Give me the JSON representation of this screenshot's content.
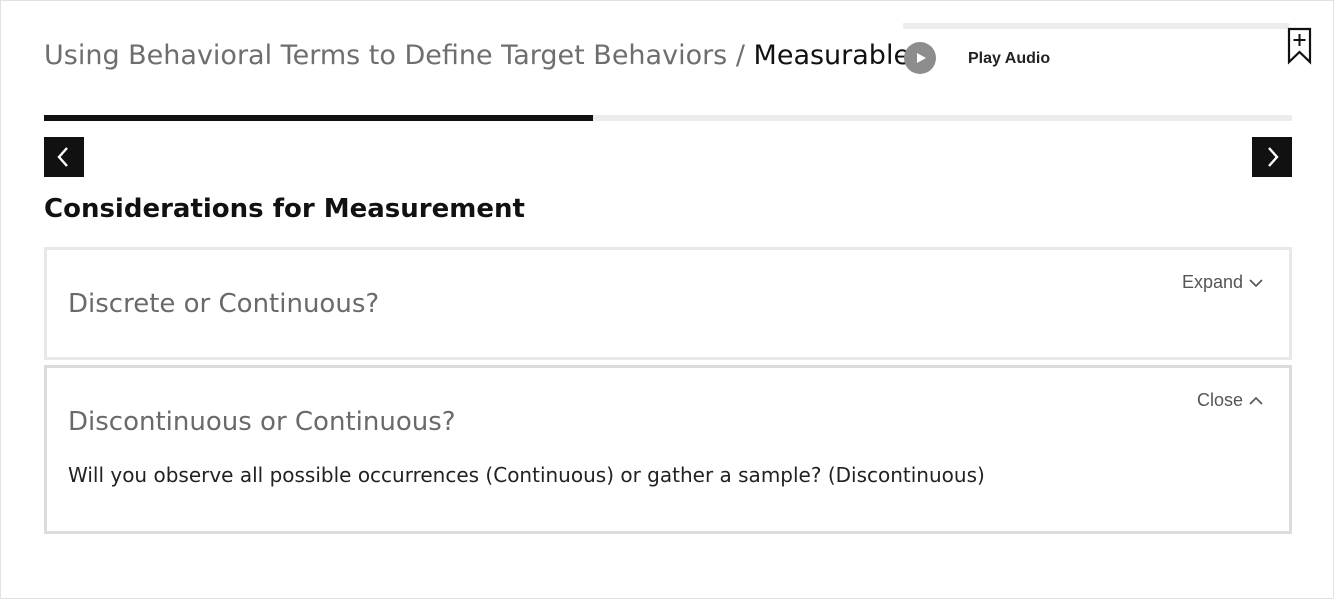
{
  "header": {
    "course_title": "Using Behavioral Terms to Define Target Behaviors",
    "separator": " / ",
    "current_page": "Measurable",
    "audio_label": "Play Audio"
  },
  "progress": {
    "fraction": 0.44
  },
  "section": {
    "title": "Considerations for Measurement"
  },
  "accordion": [
    {
      "title": "Discrete or Continuous?",
      "toggle_label": "Expand",
      "state": "collapsed"
    },
    {
      "title": "Discontinuous or Continuous?",
      "toggle_label": "Close",
      "state": "expanded",
      "body": "Will you observe all possible occurrences (Continuous) or gather a sample? (Discontinuous)"
    }
  ],
  "icons": {
    "prev": "chevron-left-icon",
    "next": "chevron-right-icon",
    "play": "play-icon",
    "bookmark": "bookmark-add-icon"
  },
  "colors": {
    "accent": "#111111",
    "muted_text": "#6e6e6e"
  }
}
